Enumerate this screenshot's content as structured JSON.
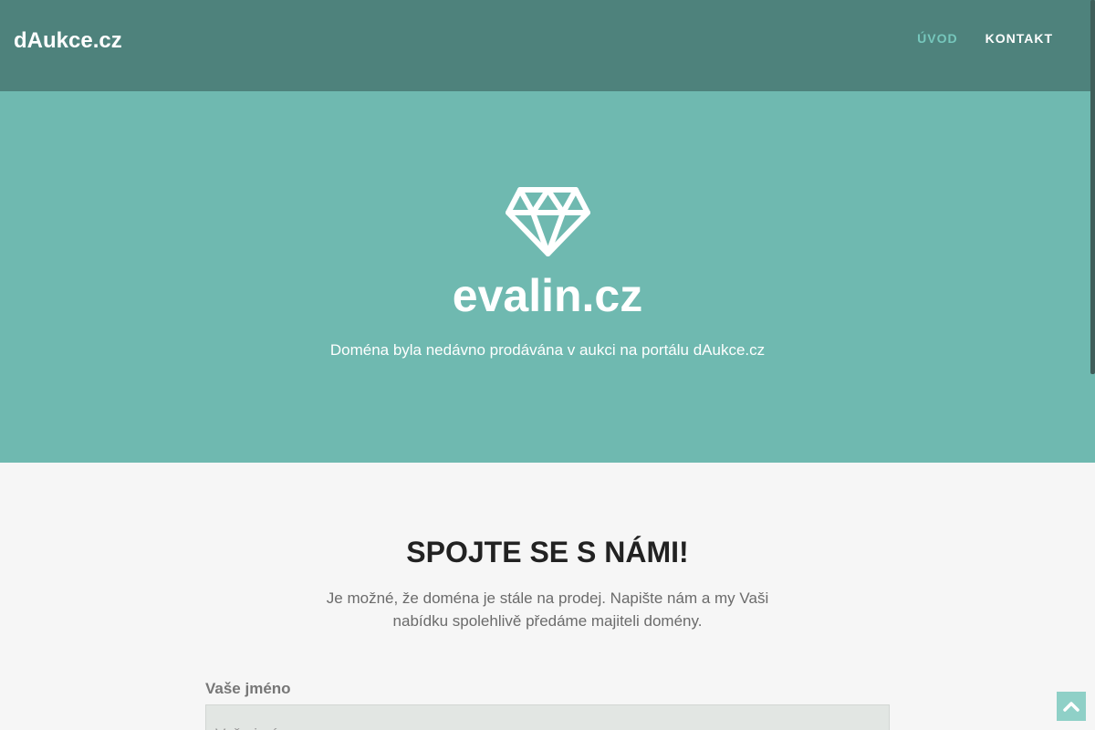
{
  "header": {
    "brand": "dAukce.cz",
    "nav": [
      {
        "label": "ÚVOD",
        "active": true
      },
      {
        "label": "KONTAKT",
        "active": false
      }
    ]
  },
  "hero": {
    "icon": "diamond-icon",
    "domain": "evalin.cz",
    "subtitle": "Doména byla nedávno prodávána v aukci na portálu dAukce.cz"
  },
  "contact": {
    "heading": "SPOJTE SE S NÁMI!",
    "lead": "Je možné, že doména je stále na prodej. Napište nám a my Vaši nabídku spolehlivě předáme majiteli domény.",
    "name_label": "Vaše jméno",
    "name_placeholder": "Vaše jméno"
  },
  "scroll_top": {
    "icon": "chevron-up-icon"
  },
  "colors": {
    "navbar": "#4e827c",
    "hero": "#6fb9b0",
    "accent": "#76c7bc",
    "background": "#f6f6f6"
  }
}
